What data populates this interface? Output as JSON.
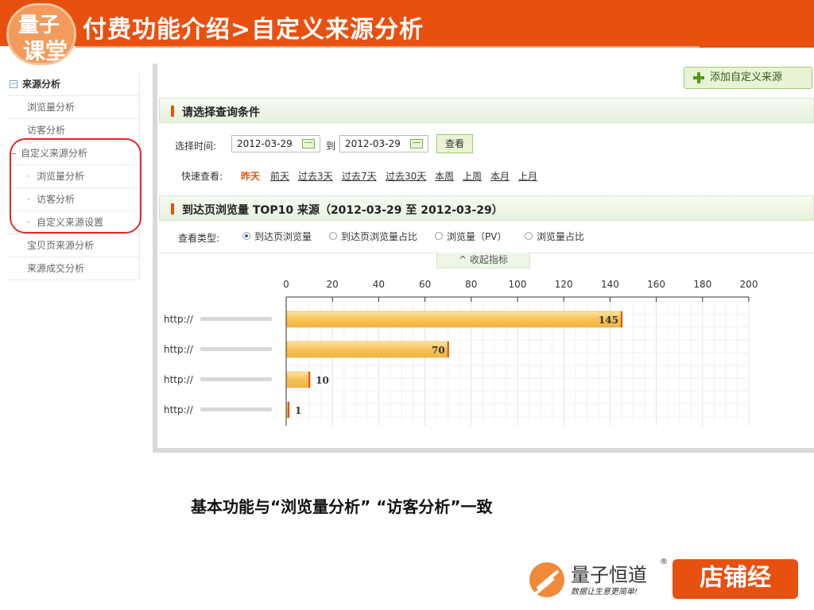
{
  "header": {
    "title": "付费功能介绍>自定义来源分析",
    "logo_line1": "量子",
    "logo_line2": "课堂"
  },
  "sidebar": {
    "root": "来源分析",
    "items": [
      {
        "label": "浏览量分析"
      },
      {
        "label": "访客分析"
      },
      {
        "label": "自定义来源分析"
      },
      {
        "label": "浏览量分析"
      },
      {
        "label": "访客分析"
      },
      {
        "label": "自定义来源设置"
      },
      {
        "label": "宝贝页来源分析"
      },
      {
        "label": "来源成交分析"
      }
    ]
  },
  "toolbar": {
    "add_label": "添加自定义来源"
  },
  "query": {
    "section_title": "请选择查询条件",
    "time_label": "选择时间:",
    "start_date": "2012-03-29",
    "to_label": "到",
    "end_date": "2012-03-29",
    "view_label": "查看",
    "quick_label": "快速查看:",
    "quick_links": [
      "昨天",
      "前天",
      "过去3天",
      "过去7天",
      "过去30天",
      "本周",
      "上周",
      "本月",
      "上月"
    ]
  },
  "report": {
    "section_title": "到达页浏览量 TOP10 来源（2012-03-29 至 2012-03-29）",
    "type_label": "查看类型:",
    "types": [
      "到达页浏览量",
      "到达页浏览量占比",
      "浏览量（PV）",
      "浏览量占比"
    ],
    "selected_type": "到达页浏览量",
    "collapse_label": "^  收起指标"
  },
  "chart_data": {
    "type": "bar",
    "orientation": "horizontal",
    "categories": [
      "http://",
      "http://",
      "http://",
      "http://"
    ],
    "values": [
      145,
      70,
      10,
      1
    ],
    "xlim": [
      0,
      200
    ],
    "xticks": [
      0,
      20,
      40,
      60,
      80,
      100,
      120,
      140,
      160,
      180,
      200
    ],
    "grid": true,
    "colors": {
      "bar": "#f7c257",
      "bar_edge": "#e8500f"
    }
  },
  "footer": {
    "note": "基本功能与“浏览量分析” “访客分析”一致"
  },
  "brand": {
    "name": "量子恒道",
    "reg": "®",
    "slogan": "数据让生意更简单!",
    "shop": "店铺经"
  }
}
